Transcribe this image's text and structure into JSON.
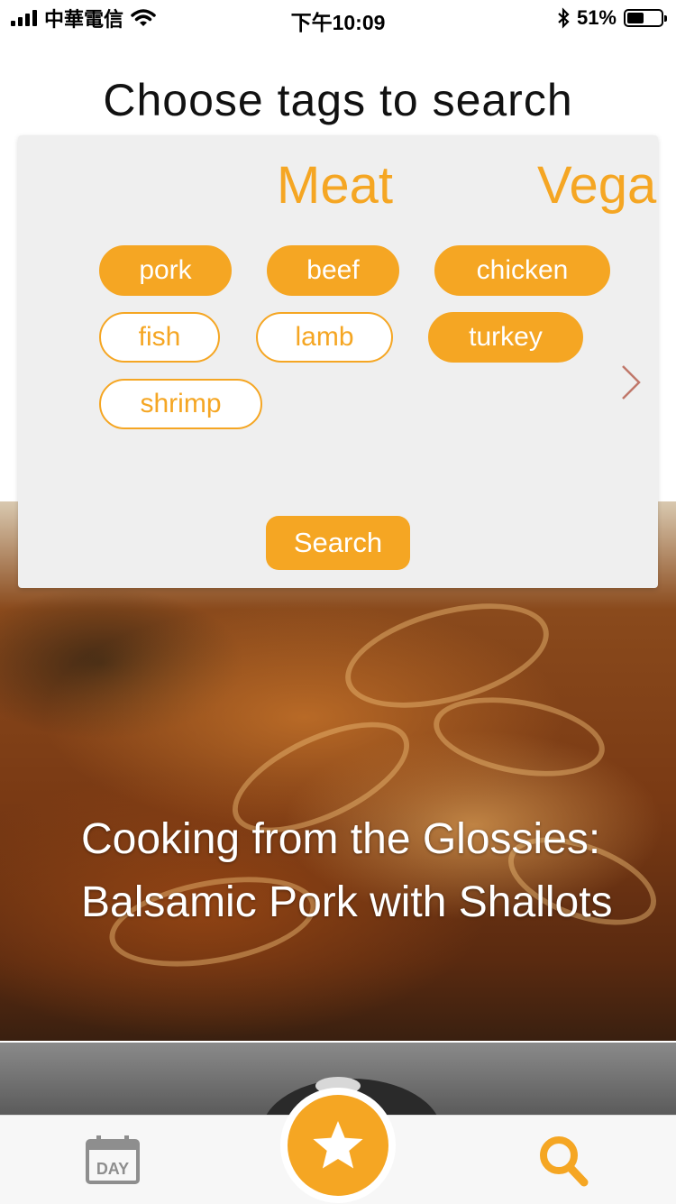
{
  "status_bar": {
    "carrier": "中華電信",
    "time": "下午10:09",
    "battery_percent": "51%",
    "battery_level": 0.51,
    "icons": [
      "signal-icon",
      "wifi-icon",
      "bluetooth-icon",
      "battery-icon"
    ]
  },
  "page": {
    "title": "Choose tags to search"
  },
  "tag_panel": {
    "categories": [
      "Meat",
      "Vega"
    ],
    "tags": [
      {
        "label": "pork",
        "selected": true
      },
      {
        "label": "beef",
        "selected": true
      },
      {
        "label": "chicken",
        "selected": true
      },
      {
        "label": "fish",
        "selected": false
      },
      {
        "label": "lamb",
        "selected": false
      },
      {
        "label": "turkey",
        "selected": true
      },
      {
        "label": "shrimp",
        "selected": false
      }
    ],
    "search_label": "Search"
  },
  "recipe": {
    "title": "Cooking from the Glossies: Balsamic Pork with Shallots"
  },
  "tab_bar": {
    "day_icon_text": "DAY",
    "icons": [
      "calendar-day-icon",
      "star-icon",
      "search-icon"
    ]
  },
  "colors": {
    "accent": "#f5a623",
    "panel": "#efefef",
    "chevron": "#c0786a"
  }
}
